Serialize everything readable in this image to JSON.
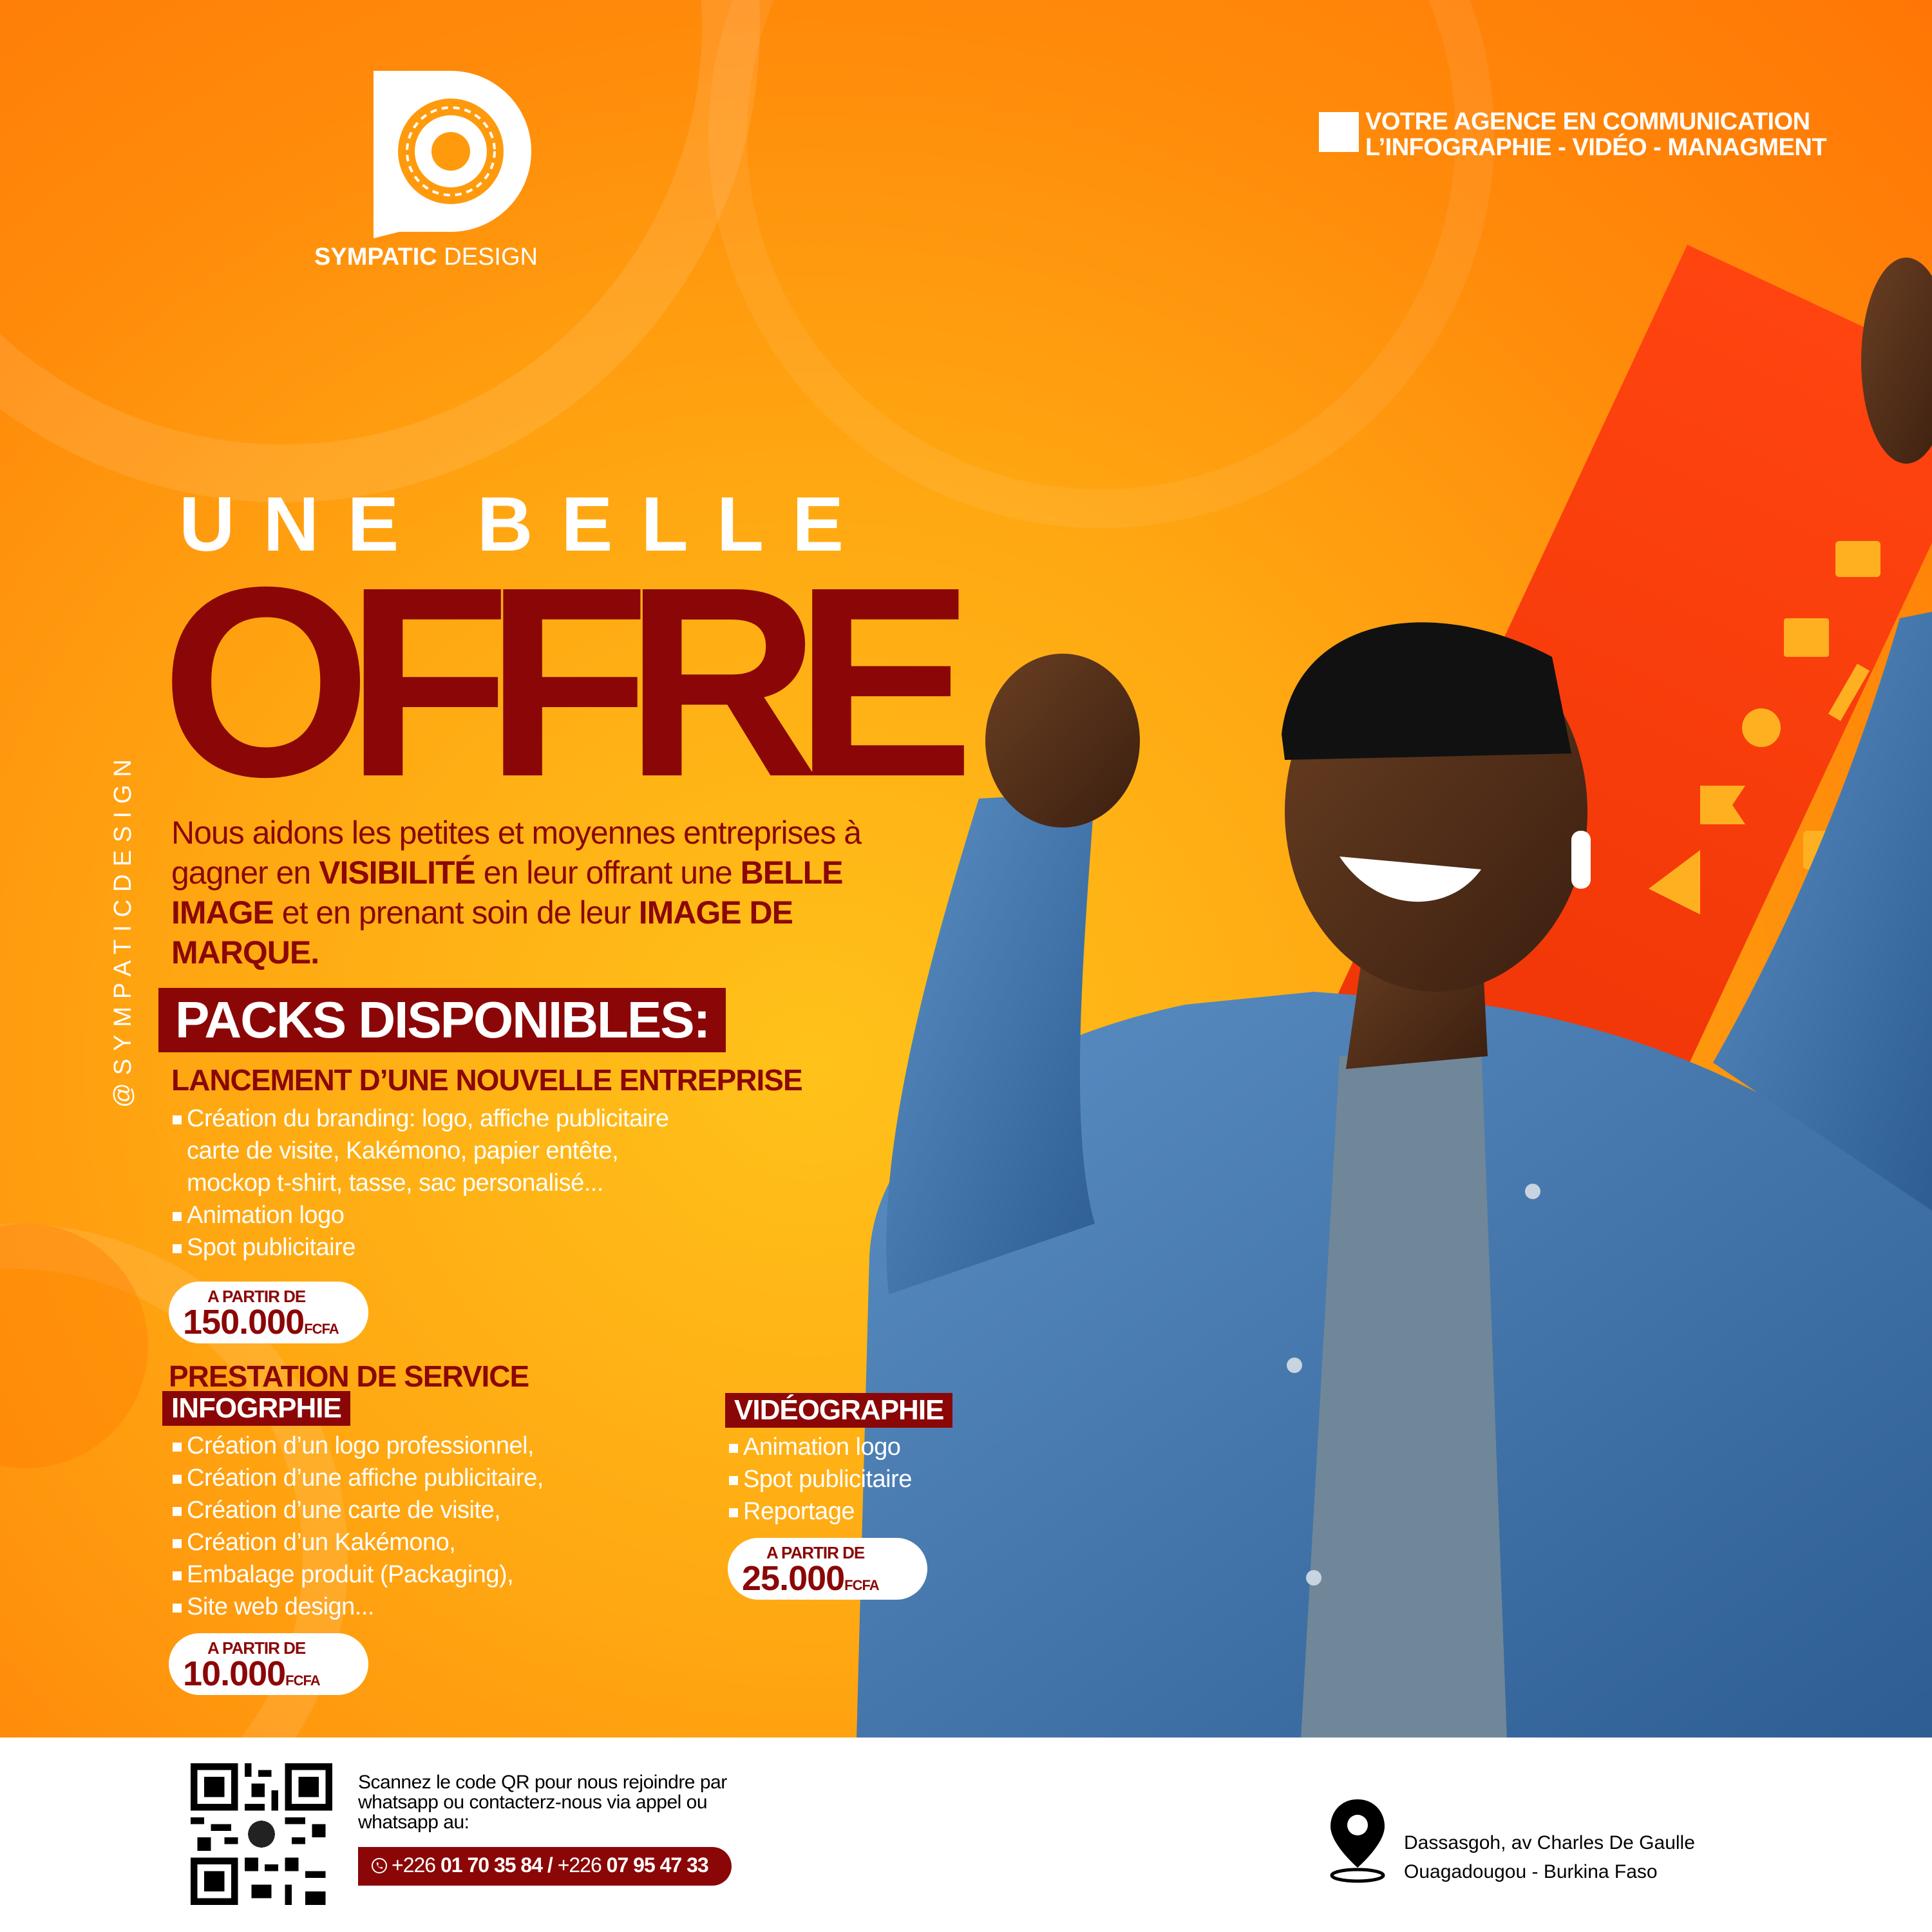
{
  "colors": {
    "background_orange": "#ff9a0c",
    "brand_red": "#8b0707",
    "white": "#ffffff"
  },
  "social_handle": "@SYMPATICDESIGN",
  "brand": {
    "name_bold": "SYMPATIC",
    "name_light": "DESIGN",
    "logo_icon": "sympatic-design-logo"
  },
  "tagline": {
    "line1": "VOTRE AGENCE EN COMMUNICATION",
    "line2": "L’INFOGRAPHIE - VIDÉO - MANAGMENT"
  },
  "headline": {
    "top": "UNE BELLE",
    "main": "OFFRE"
  },
  "intro": {
    "p1": "Nous aidons les petites et moyennes entreprises à gagner en ",
    "b1": "VISIBILITÉ",
    "p2": " en leur offrant une ",
    "b2": "BELLE IMAGE",
    "p3": " et en prenant soin de leur ",
    "b3": "IMAGE DE MARQUE."
  },
  "packs": {
    "title": "PACKS DISPONIBLES:",
    "launch": {
      "title": "LANCEMENT D’UNE NOUVELLE ENTREPRISE",
      "items": [
        "Création du branding: logo, affiche publicitaire",
        "carte de visite, Kakémono, papier  entête,",
        "mockop t-shirt, tasse, sac personalisé...",
        "Animation logo",
        "Spot publicitaire"
      ],
      "price": {
        "label": "A PARTIR DE",
        "value": "150.000",
        "currency": "FCFA"
      }
    },
    "service": {
      "title": "PRESTATION DE SERVICE",
      "infographie": {
        "title": "INFOGRPHIE",
        "items": [
          "Création d’un logo professionnel,",
          "Création d’une affiche publicitaire,",
          "Création d’une carte de visite,",
          "Création d’un Kakémono,",
          "Embalage produit (Packaging),",
          "Site web design..."
        ],
        "price": {
          "label": "A PARTIR DE",
          "value": "10.000",
          "currency": "FCFA"
        }
      },
      "videographie": {
        "title": "VIDÉOGRAPHIE",
        "items": [
          "Animation logo",
          "Spot publicitaire",
          "Reportage"
        ],
        "price": {
          "label": "A PARTIR DE",
          "value": "25.000",
          "currency": "FCFA"
        }
      }
    }
  },
  "footer": {
    "qr_icon": "qr-code",
    "qr_text": "Scannez le code QR pour nous rejoindre par whatsapp ou contacterz-nous via appel ou whatsapp au:",
    "phones": {
      "p1_prefix": "+226 ",
      "p1": "01 70 35 84",
      "sep": " / ",
      "p2_prefix": "+226 ",
      "p2": "07 95 47 33"
    },
    "phone_icon": "whatsapp-icon",
    "location_icon": "location-pin-icon",
    "address_line1": "Dassasgoh, av  Charles De Gaulle",
    "address_line2": "Ouagadougou - Burkina Faso"
  }
}
